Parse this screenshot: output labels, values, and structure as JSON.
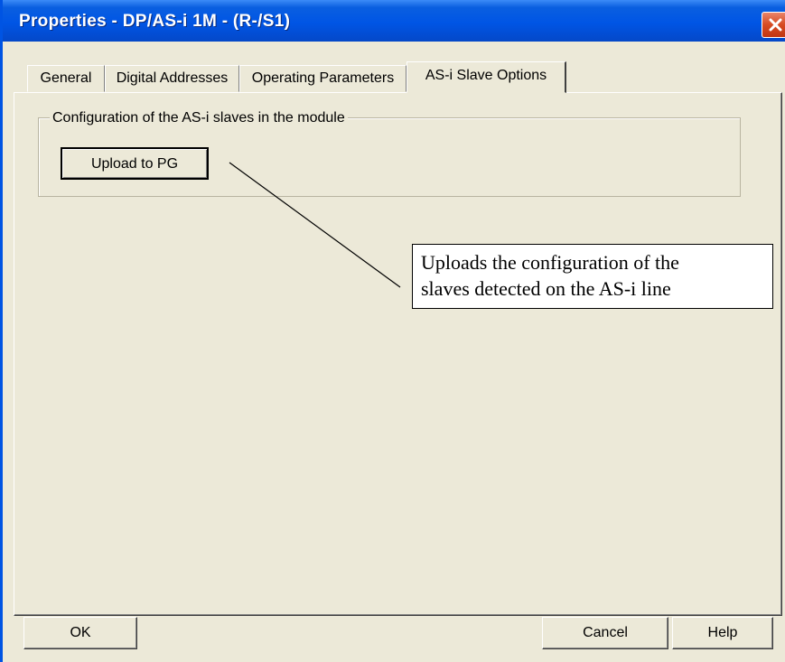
{
  "window": {
    "title": "Properties - DP/AS-i 1M - (R-/S1)"
  },
  "tabs": [
    {
      "label": "General",
      "active": false
    },
    {
      "label": "Digital Addresses",
      "active": false
    },
    {
      "label": "Operating Parameters",
      "active": false
    },
    {
      "label": "AS-i Slave Options",
      "active": true
    }
  ],
  "group": {
    "label": "Configuration of the AS-i slaves in the module",
    "upload_button": "Upload to PG"
  },
  "callout": {
    "line1": "Uploads the configuration of the",
    "line2": "slaves detected on the AS-i line"
  },
  "footer": {
    "ok_label": "OK",
    "cancel_label": "Cancel",
    "help_label": "Help"
  },
  "colors": {
    "titlebar": "#0055e5",
    "close": "#d64b22",
    "face": "#ece9d8"
  },
  "icons": {
    "close": "close-icon"
  }
}
